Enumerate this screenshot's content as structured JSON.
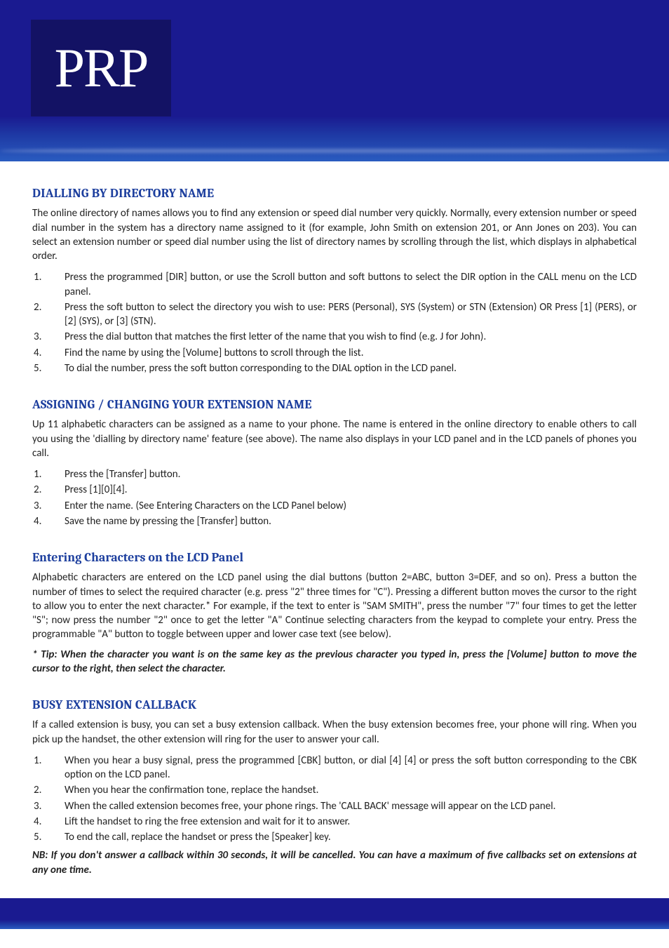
{
  "logo": {
    "text": "PRP"
  },
  "sections": [
    {
      "id": "dialling",
      "heading": "DIALLING BY DIRECTORY NAME",
      "heading_style": "upper",
      "intro": "The online directory of names allows you to find any extension or speed dial number very quickly. Normally, every extension number or speed dial number in the system has a directory name assigned to it (for example, John Smith on extension 201, or Ann Jones on 203). You can select an extension number or speed dial number using the list of directory names by scrolling through the list, which displays in alphabetical order.",
      "steps": [
        "Press the programmed [DIR] button, or use the Scroll button and soft buttons to select the DIR option in the CALL menu on the LCD panel.",
        "Press the soft button to select the directory you wish to use: PERS (Personal), SYS (System) or STN (Extension) OR Press [1] (PERS), or [2] (SYS), or [3] (STN).",
        "Press the dial button that matches the first letter of the name that you wish to find (e.g. J for John).",
        "Find the name by using the [Volume] buttons to scroll through the list.",
        "To dial the number, press the soft button corresponding to the DIAL option in the LCD panel."
      ]
    },
    {
      "id": "assign-name",
      "heading": "ASSIGNING / CHANGING YOUR EXTENSION NAME",
      "heading_style": "upper",
      "intro": "Up 11 alphabetic characters can be assigned as a name to your phone. The name is entered in the online directory to enable others to call you using the 'dialling by directory name' feature (see above). The name also displays in your LCD panel and in the LCD panels of phones you call.",
      "steps": [
        "Press the [Transfer] button.",
        "Press [1][0][4].",
        "Enter the name. (See Entering Characters on the LCD Panel below)",
        "Save the name by pressing the [Transfer] button."
      ]
    },
    {
      "id": "entering-chars",
      "heading": "Entering Characters on the LCD Panel",
      "heading_style": "mixed",
      "intro": "Alphabetic characters are entered on the LCD panel using the dial buttons (button 2=ABC, button 3=DEF, and so on). Press a button the number of times to select the required character (e.g. press \"2\" three times for \"C\"). Pressing a different button moves the cursor to the right to allow you to enter the next character.* For example, if the text to enter is \"SAM SMITH\", press the number \"7\" four times to get the letter \"S\"; now press the number \"2\" once to get the letter \"A\" Continue selecting characters from the keypad to complete your entry. Press the programmable \"A\" button to toggle between upper and lower case text (see below).",
      "note": "* Tip: When the character you want is on the same key as the previous character you typed in, press the [Volume] button to move the cursor to the right, then select the character."
    },
    {
      "id": "busy-callback",
      "heading": "BUSY EXTENSION CALLBACK",
      "heading_style": "upper",
      "intro": "If a called extension is busy, you can set a busy extension callback. When the busy extension becomes free, your phone will ring. When you pick up the handset, the other extension will ring for the user to answer your call.",
      "steps": [
        "When you hear a busy signal, press the programmed [CBK] button, or dial [4] [4] or press the soft button corresponding to the CBK option on the LCD panel.",
        "When you hear the confirmation tone, replace the handset.",
        "When the called extension becomes free, your phone rings. The 'CALL BACK' message will appear on the LCD panel.",
        "Lift the handset to ring the free extension and wait for it to answer.",
        "To end the call, replace the handset or press the [Speaker] key."
      ],
      "note": "NB: If you don't answer a callback within 30 seconds, it will be cancelled. You can have a maximum of five callbacks set on extensions at any one time."
    }
  ]
}
